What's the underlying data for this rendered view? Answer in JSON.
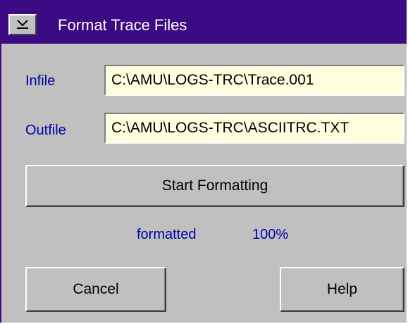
{
  "window": {
    "title": "Format Trace Files",
    "system_menu_glyph": "≚"
  },
  "form": {
    "infile_label": "Infile",
    "infile_value": "C:\\AMU\\LOGS-TRC\\Trace.001",
    "outfile_label": "Outfile",
    "outfile_value": "C:\\AMU\\LOGS-TRC\\ASCIITRC.TXT"
  },
  "actions": {
    "start_label": "Start Formatting",
    "cancel_label": "Cancel",
    "help_label": "Help"
  },
  "status": {
    "text": "formatted",
    "percent": "100%"
  },
  "colors": {
    "titlebar": "#3c0a82",
    "window_bg": "#c0c0c0",
    "field_bg": "#ffffe0",
    "label_text": "#0000a8"
  },
  "icons": {
    "system_menu": "system-menu-icon"
  }
}
